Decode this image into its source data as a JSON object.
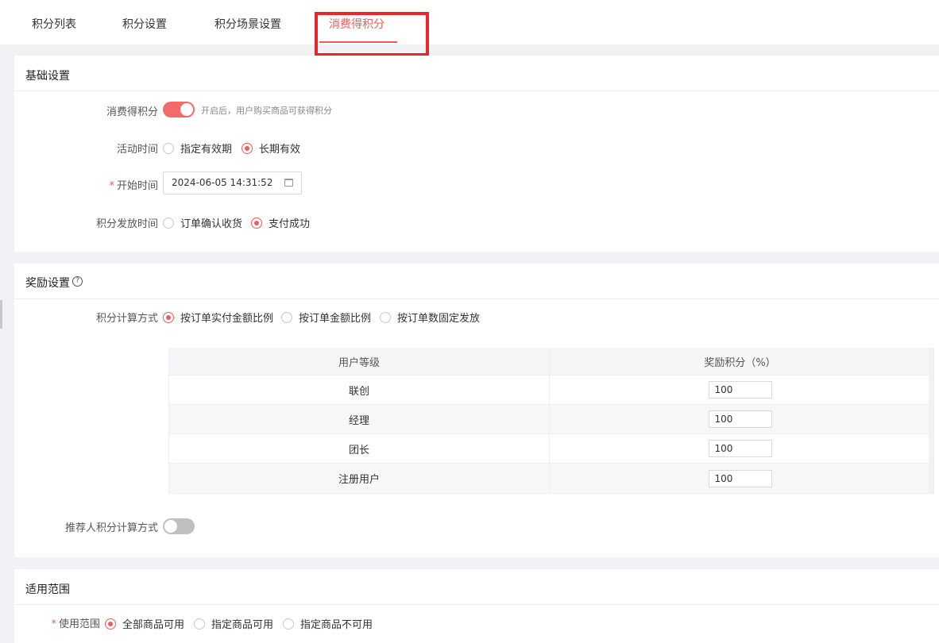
{
  "tabs": [
    {
      "label": "积分列表"
    },
    {
      "label": "积分设置"
    },
    {
      "label": "积分场景设置"
    },
    {
      "label": "消费得积分"
    }
  ],
  "active_tab": "消费得积分",
  "basic": {
    "title": "基础设置",
    "consume_label": "消费得积分",
    "consume_enabled": true,
    "consume_hint": "开启后，用户购买商品可获得积分",
    "activity_time_label": "活动时间",
    "activity_time_options": [
      "指定有效期",
      "长期有效"
    ],
    "activity_time_selected": "长期有效",
    "start_time_required": "*",
    "start_time_label": "开始时间",
    "start_time_value": "2024-06-05 14:31:52",
    "issue_time_label": "积分发放时间",
    "issue_time_options": [
      "订单确认收货",
      "支付成功"
    ],
    "issue_time_selected": "支付成功"
  },
  "reward": {
    "title": "奖励设置",
    "help_icon": "?",
    "calc_label": "积分计算方式",
    "calc_options": [
      "按订单实付金额比例",
      "按订单金额比例",
      "按订单数固定发放"
    ],
    "calc_selected": "按订单实付金额比例",
    "table": {
      "headers": [
        "用户等级",
        "奖励积分（%）"
      ],
      "rows": [
        {
          "level": "联创",
          "value": "100"
        },
        {
          "level": "经理",
          "value": "100"
        },
        {
          "level": "团长",
          "value": "100"
        },
        {
          "level": "注册用户",
          "value": "100"
        }
      ]
    },
    "referrer_label": "推荐人积分计算方式",
    "referrer_enabled": false
  },
  "scope": {
    "title": "适用范围",
    "usage_required": "*",
    "usage_label": "使用范围",
    "usage_options": [
      "全部商品可用",
      "指定商品可用",
      "指定商品不可用"
    ],
    "usage_selected": "全部商品可用"
  },
  "colors": {
    "accent": "#f25b5b",
    "highlight_box": "#e8262b"
  }
}
